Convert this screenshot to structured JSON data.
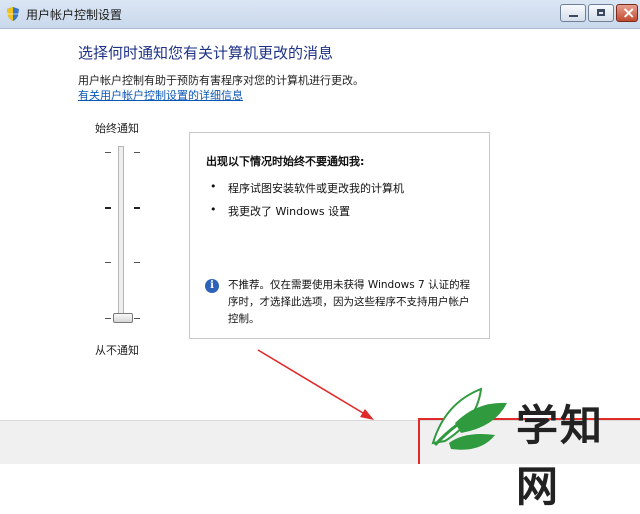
{
  "window": {
    "title": "用户帐户控制设置"
  },
  "main": {
    "heading": "选择何时通知您有关计算机更改的消息",
    "description": "用户帐户控制有助于预防有害程序对您的计算机进行更改。",
    "link": "有关用户帐户控制设置的详细信息"
  },
  "slider": {
    "top_label": "始终通知",
    "bottom_label": "从不通知",
    "level": 1,
    "level_count": 4
  },
  "info_box": {
    "title": "出现以下情况时始终不要通知我:",
    "bullets": [
      "程序试图安装软件或更改我的计算机",
      "我更改了 Windows 设置"
    ],
    "bullet_glyph": "•",
    "note_icon": "i",
    "note": "不推荐。仅在需要使用未获得 Windows 7 认证的程序时，才选择此选项，因为这些程序不支持用户帐户控制。"
  },
  "watermark": {
    "text": "学知网"
  },
  "colors": {
    "heading": "#1e3287",
    "link": "#0b57b7",
    "annotation": "#e02a2a",
    "watermark_green": "#2f9a3e"
  }
}
